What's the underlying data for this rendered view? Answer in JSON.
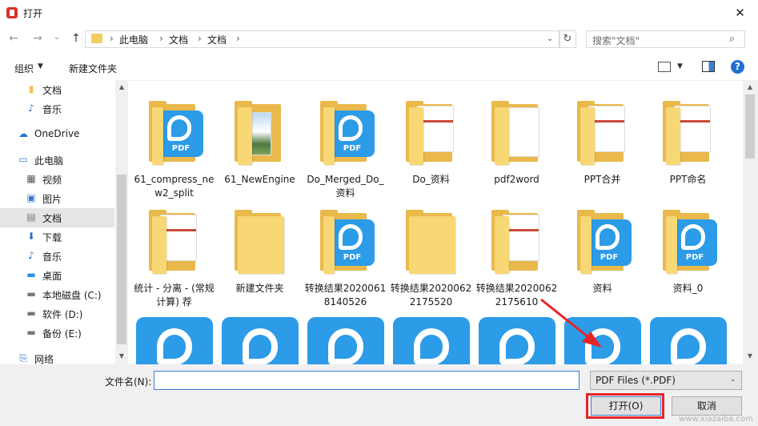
{
  "window": {
    "title": "打开",
    "close_glyph": "✕"
  },
  "nav_buttons": {
    "back": "←",
    "forward": "→",
    "recent": "⌄",
    "up": "↑"
  },
  "address": {
    "crumbs": [
      "此电脑",
      "文档",
      "文档"
    ],
    "separator": "›",
    "dropdown": "⌄"
  },
  "refresh_glyph": "↻",
  "search": {
    "placeholder": "搜索\"文档\"",
    "icon": "search-icon"
  },
  "toolbar": {
    "organize": "组织",
    "caret": "▼",
    "new_folder": "新建文件夹",
    "help": "?"
  },
  "sidebar": {
    "items": [
      {
        "label": "文档",
        "icon": "folder-icon"
      },
      {
        "label": "音乐",
        "icon": "music-icon"
      },
      {
        "label": "OneDrive",
        "icon": "cloud-icon"
      },
      {
        "label": "此电脑",
        "icon": "computer-icon"
      },
      {
        "label": "视频",
        "icon": "video-icon"
      },
      {
        "label": "图片",
        "icon": "picture-icon"
      },
      {
        "label": "文档",
        "icon": "document-icon",
        "selected": true
      },
      {
        "label": "下载",
        "icon": "download-icon"
      },
      {
        "label": "音乐",
        "icon": "music-icon"
      },
      {
        "label": "桌面",
        "icon": "desktop-icon"
      },
      {
        "label": "本地磁盘 (C:)",
        "icon": "drive-icon"
      },
      {
        "label": "软件 (D:)",
        "icon": "drive-icon"
      },
      {
        "label": "备份 (E:)",
        "icon": "drive-icon"
      },
      {
        "label": "网络",
        "icon": "network-icon"
      }
    ]
  },
  "files": [
    {
      "name": "61_compress_new2_split",
      "kind": "pdf-folder"
    },
    {
      "name": "61_NewEngine",
      "kind": "image-folder"
    },
    {
      "name": "Do_Merged_Do_资料",
      "kind": "pdf-folder"
    },
    {
      "name": "Do_资料",
      "kind": "docs-folder"
    },
    {
      "name": "pdf2word",
      "kind": "blank-folder"
    },
    {
      "name": "PPT合并",
      "kind": "docs-folder"
    },
    {
      "name": "PPT命名",
      "kind": "docs-folder"
    },
    {
      "name": "统计 - 分离 - (常规计算) 荐",
      "kind": "docs-folder"
    },
    {
      "name": "新建文件夹",
      "kind": "empty-folder"
    },
    {
      "name": "转换结果20200618140526",
      "kind": "pdf-folder"
    },
    {
      "name": "转换结果20200622175520",
      "kind": "empty-folder"
    },
    {
      "name": "转换结果20200622175610",
      "kind": "docs-folder"
    },
    {
      "name": "资料",
      "kind": "pdf-folder"
    },
    {
      "name": "资料_0",
      "kind": "pdf-folder"
    }
  ],
  "third_row_count": 7,
  "bottom": {
    "filename_label": "文件名(N):",
    "filename_value": "",
    "filetype": "PDF Files (*.PDF)",
    "open": "打开(O)",
    "cancel": "取消",
    "dd": "⌄"
  },
  "colors": {
    "accent": "#3b7ed1",
    "pdf_blue": "#2c9be8",
    "folder": "#f8d775",
    "annotation_red": "#e5242a"
  },
  "watermark": "www.xiazaiba.com"
}
